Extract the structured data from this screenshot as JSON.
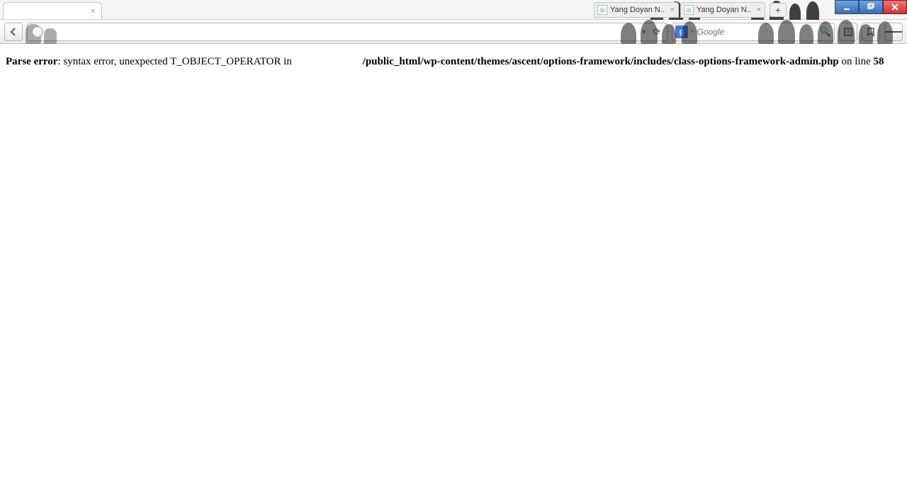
{
  "window": {
    "controls": {
      "min": "–",
      "max": "❐",
      "close": "✕"
    }
  },
  "tabs": {
    "active_close": "×",
    "bg": [
      {
        "label": "Yang Doyan N..",
        "close": "×"
      },
      {
        "label": "Yang Doyan N..",
        "close": "×"
      }
    ],
    "newtab": "+"
  },
  "toolbar": {
    "back": "←",
    "url_value": "",
    "url_dropdown": "▼",
    "reload": "⟳",
    "search_engine_letter": "g",
    "search_sep": "▾",
    "search_placeholder": "Google",
    "search_go": "🔍"
  },
  "error": {
    "label": "Parse error",
    "message": ": syntax error, unexpected T_OBJECT_OPERATOR in ",
    "path": "/public_html/wp-content/themes/ascent/options-framework/includes/class-options-framework-admin.php",
    "online": " on line ",
    "line": "58"
  }
}
